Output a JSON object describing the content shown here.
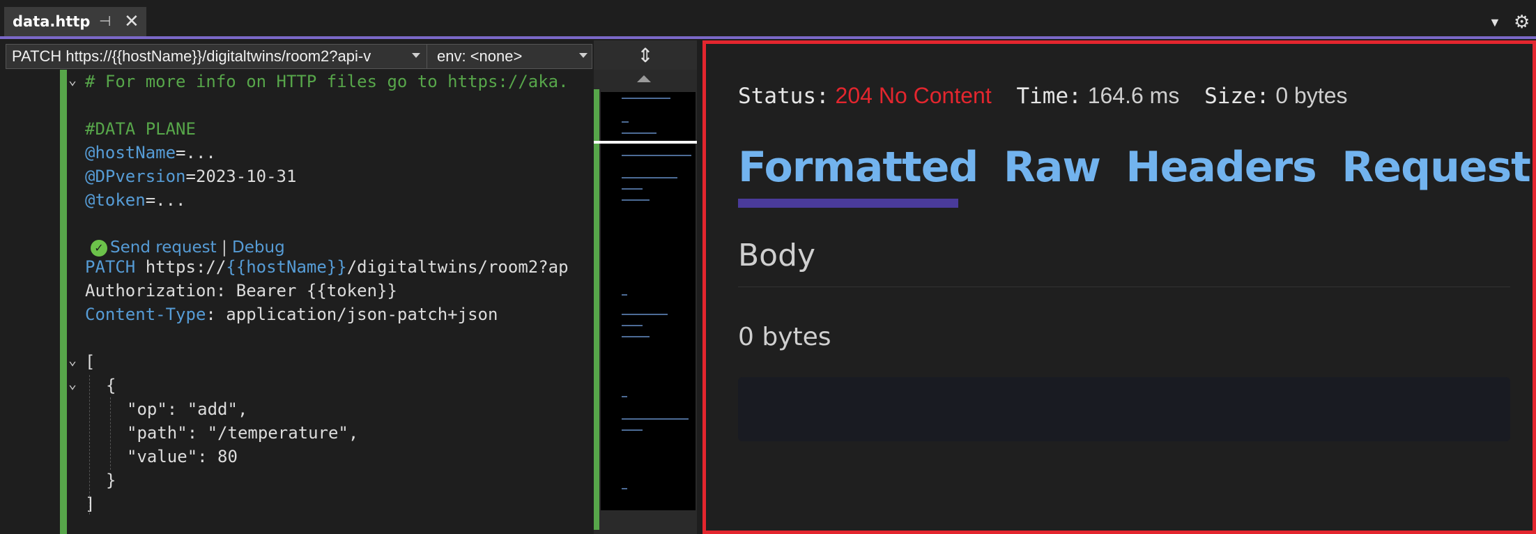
{
  "tab": {
    "title": "data.http"
  },
  "request_bar": {
    "request": "PATCH https://{{hostName}}/digitaltwins/room2?api-v",
    "env": "env: <none>"
  },
  "editor": {
    "lines": [
      "# For more info on HTTP files go to https://aka.",
      "#DATA PLANE",
      "@hostName",
      "=...",
      "@DPversion",
      "=2023-10-31",
      "@token",
      "=...",
      "PATCH",
      "https://",
      "{{hostName}}",
      "/digitaltwins/room2?ap",
      "Authorization: Bearer {{token}}",
      "Content-Type",
      ": application/json-patch+json",
      "[",
      "{",
      "\"op\": \"add\",",
      "\"path\": \"/temperature\",",
      "\"value\": 80",
      "}",
      "]"
    ],
    "codelens": {
      "send": "Send request",
      "sep": "|",
      "debug": "Debug"
    }
  },
  "response": {
    "status_label": "Status:",
    "status_value": "204 No Content",
    "time_label": "Time:",
    "time_value": "164.6 ms",
    "size_label": "Size:",
    "size_value": "0 bytes",
    "tabs": [
      "Formatted",
      "Raw",
      "Headers",
      "Request"
    ],
    "active_tab": "Formatted",
    "body_title": "Body",
    "body_size": "0 bytes"
  },
  "colors": {
    "accent": "#7b68c8",
    "status_error": "#e3262e",
    "tab_link": "#72b3ee",
    "comment": "#57a64a",
    "keyword": "#569cd6"
  }
}
